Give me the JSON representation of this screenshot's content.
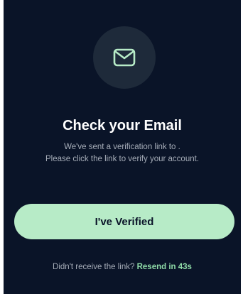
{
  "screen": {
    "title": "Check your Email",
    "description_line1": "We've sent a verification link to .",
    "description_line2": "Please click the link to verify your account.",
    "icon": "mail-icon"
  },
  "actions": {
    "verified_label": "I've Verified"
  },
  "resend": {
    "prefix": "Didn't receive the link?",
    "link_label": "Resend in 43s"
  },
  "colors": {
    "background": "#0a1428",
    "icon_circle": "#1e2a3a",
    "accent": "#b7ebc7",
    "accent_text": "#8fdca8",
    "muted_text": "#a6adb8"
  }
}
